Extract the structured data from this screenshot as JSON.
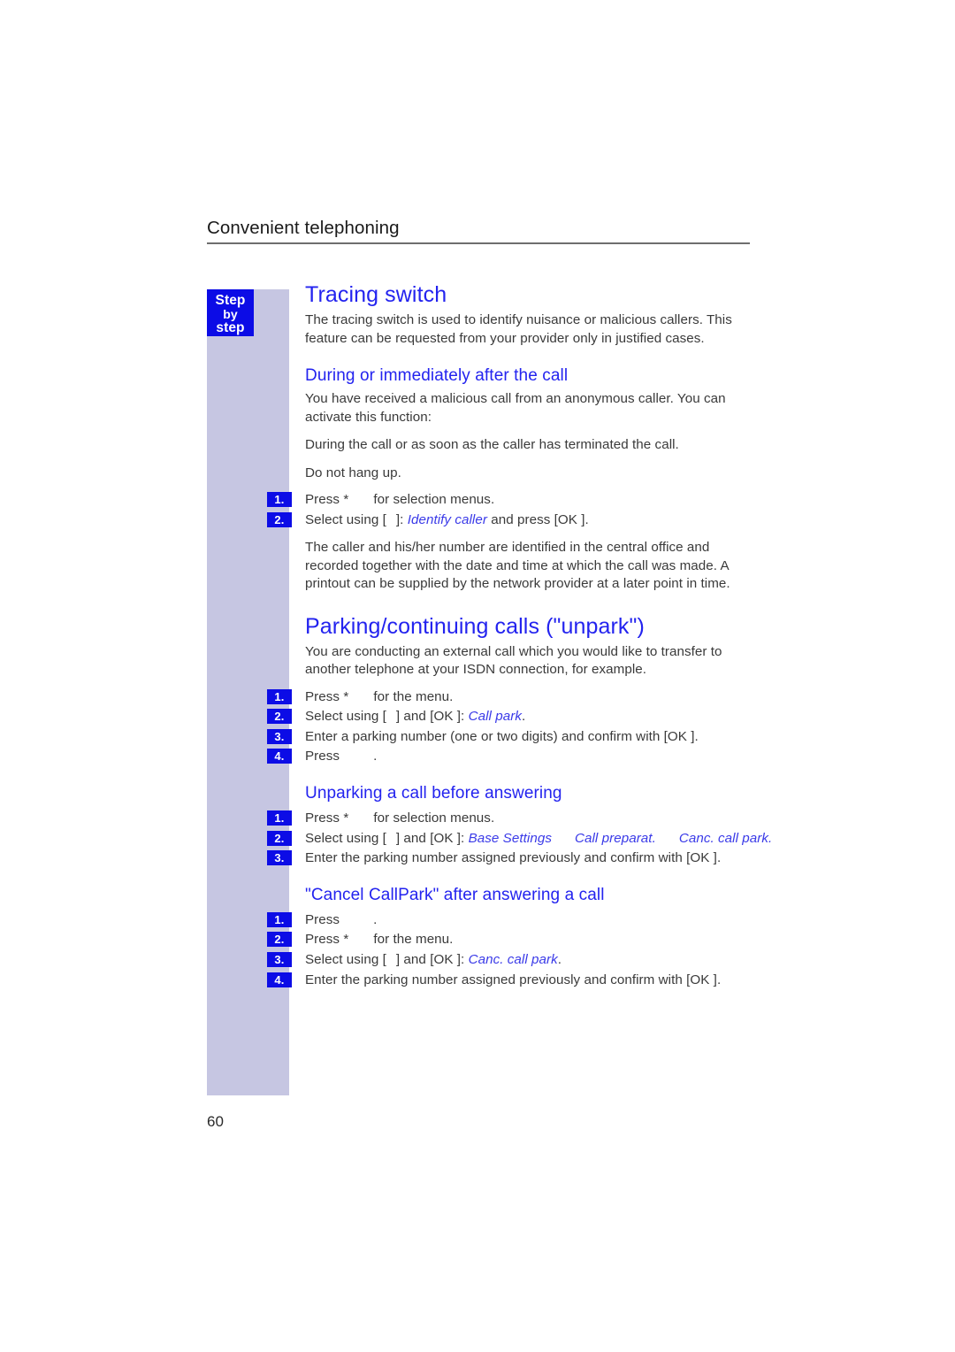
{
  "page": {
    "running_header": "Convenient telephoning",
    "folio": "60"
  },
  "margin_column": {
    "step_badge": {
      "line1": "Step",
      "line2": "by",
      "line3": "step"
    }
  },
  "sections": [
    {
      "id": "tracing-switch",
      "title": "Tracing switch",
      "intro": "The tracing switch is used to identify nuisance or malicious callers. This feature can be requested from your provider only in justified cases.",
      "subsections": [
        {
          "id": "during-or-after-call",
          "title": "During or immediately after the call",
          "paragraphs": [
            "You have received a malicious call from an anonymous caller. You can activate this function:",
            "During the call or as soon as the caller has terminated the call.",
            "Do not hang up."
          ],
          "steps": [
            {
              "num": "1.",
              "pre": "Press *",
              "post": "for selection menus."
            },
            {
              "num": "2.",
              "pre": "Select using [",
              "mid": "]: ",
              "italic": "Identify caller",
              "post": " and press [OK ]."
            }
          ],
          "trailing": "The caller and his/her number are identified in the central office and recorded together with the date and time at which the call was made. A printout can be supplied by the network provider at a later point in time."
        }
      ]
    },
    {
      "id": "parking-continuing-calls",
      "title": "Parking/continuing calls (\"unpark\")",
      "intro": "You are conducting an external call which you would like to transfer to another telephone at your ISDN connection, for example.",
      "steps": [
        {
          "num": "1.",
          "pre": "Press *",
          "post": "for the menu."
        },
        {
          "num": "2.",
          "pre": "Select using [",
          "mid": "] and [OK ]: ",
          "italic": "Call park",
          "post": "."
        },
        {
          "num": "3.",
          "pre": "Enter a parking number (one or two digits) and confirm with [OK ].",
          "post": ""
        },
        {
          "num": "4.",
          "pre": "Press",
          "post": "."
        }
      ],
      "subsections": [
        {
          "id": "unparking-before-answering",
          "title": "Unparking a call before answering",
          "steps": [
            {
              "num": "1.",
              "pre": "Press *",
              "post": "for selection menus."
            },
            {
              "num": "2.",
              "pre": "Select using [",
              "mid": "] and [OK ]: ",
              "italic1": "Base Settings",
              "italic2": "Call preparat.",
              "italic3": "Canc. call park.",
              "post": ""
            },
            {
              "num": "3.",
              "pre": "Enter the parking number assigned previously and confirm with [OK ].",
              "post": ""
            }
          ]
        },
        {
          "id": "cancel-callpark-after-answering",
          "title": "\"Cancel CallPark\" after answering a call",
          "steps": [
            {
              "num": "1.",
              "pre": "Press",
              "post": "."
            },
            {
              "num": "2.",
              "pre": "Press *",
              "post": "for the menu."
            },
            {
              "num": "3.",
              "pre": "Select using [",
              "mid": "] and [OK ]: ",
              "italic": "Canc. call park",
              "post": "."
            },
            {
              "num": "4.",
              "pre": "Enter the parking number assigned previously and confirm with [OK ].",
              "post": ""
            }
          ]
        }
      ]
    }
  ]
}
